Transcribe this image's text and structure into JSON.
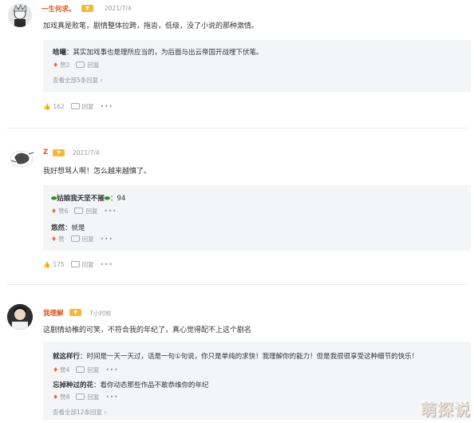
{
  "comments": [
    {
      "user": "一生何求。",
      "time": "2021/7/4",
      "text": "加戏真是败笔，剧情整体拉跨，拖沓，低级，没了小说的那种激情。",
      "replies": [
        {
          "name": "晗曦",
          "text": "：其实加戏事也是理所应当的，为后面与出云帝国开战埋下伏笔。",
          "likes": "赞2",
          "reply_label": "回复"
        }
      ],
      "view_all": "查看全部5条回复",
      "likes": "162",
      "reply_label": "回复"
    },
    {
      "user": "Z",
      "time": "2021/7/4",
      "text": "我好想骂人啊！怎么越来越慎了。",
      "replies": [
        {
          "name": "姑娘我天坚不摧",
          "text": "：94",
          "likes": "赞6",
          "reply_label": "回复"
        },
        {
          "name": "悠然",
          "text": "：就是",
          "likes": "赞",
          "reply_label": "回复"
        }
      ],
      "likes": "175",
      "reply_label": "回复"
    },
    {
      "user": "我理解",
      "time": "7小时前",
      "text": "这剧情幼稚的可笑，不符合我的年纪了，真心觉得配不上这个剧名",
      "replies": [
        {
          "name": "就这样行",
          "text": "：时间是一天一天过，话是一句①句说，你只是单纯的求快！我理解你的能力！但是我很很享受这种细节的快乐！",
          "likes": "赞4",
          "reply_label": "回复"
        },
        {
          "name": "忘掉种过的花",
          "text": "：看你动态那些作品不敢恭维你的年纪",
          "likes": "赞8",
          "reply_label": "回复"
        }
      ],
      "view_all": "查看全部12条回复"
    }
  ],
  "watermark": "萌探说",
  "colors": {
    "username": "#e0561b",
    "badge": "#f6b83a",
    "reply_bg": "#f4f5f7",
    "muted": "#999999"
  },
  "icons": {
    "like": "flame-icon",
    "reply": "reply-icon",
    "more": "more-dots-icon",
    "thumb": "thumb-up-icon",
    "view_all": "chevron-right-icon"
  }
}
